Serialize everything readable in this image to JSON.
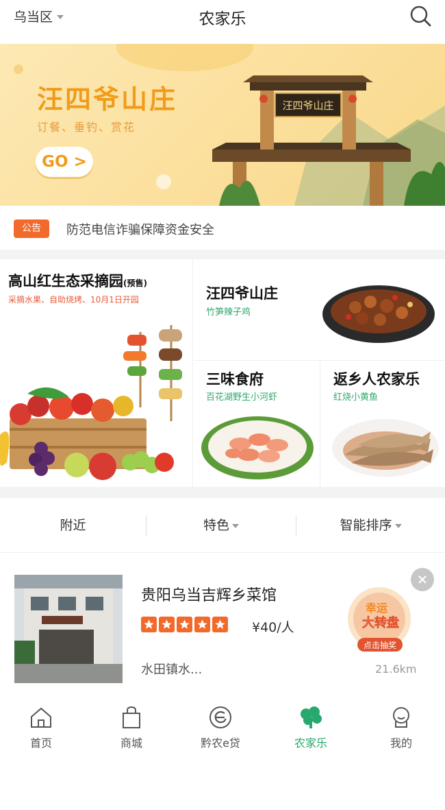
{
  "header": {
    "district": "乌当区",
    "title": "农家乐"
  },
  "banner": {
    "title": "汪四爷山庄",
    "subtitle": "订餐、垂钓、赏花",
    "button_label": "GO >",
    "gate_sign": "汪四爷山庄"
  },
  "notice": {
    "badge": "公告",
    "text": "防范电信诈骗保障资金安全"
  },
  "promo": {
    "left": {
      "title": "高山红生态采摘园",
      "tag": "(预售)",
      "subtitle": "采摘水果、自助烧烤、10月1日开园"
    },
    "cells": [
      {
        "title": "汪四爷山庄",
        "subtitle": "竹笋辣子鸡"
      },
      {
        "title": "三味食府",
        "subtitle": "百花湖野生小河虾"
      },
      {
        "title": "返乡人农家乐",
        "subtitle": "红烧小黄鱼"
      }
    ]
  },
  "filters": [
    {
      "label": "附近"
    },
    {
      "label": "特色"
    },
    {
      "label": "智能排序"
    }
  ],
  "restaurant": {
    "name": "贵阳乌当吉辉乡菜馆",
    "rating": 5,
    "rating_max": 5,
    "price": "¥40/人",
    "address": "水田镇水...",
    "distance": "21.6km",
    "lucky_badge_line1": "幸运",
    "lucky_badge_line2": "大转盘",
    "lucky_badge_button": "点击抽奖"
  },
  "tabbar": [
    {
      "label": "首页",
      "icon": "home-icon"
    },
    {
      "label": "商城",
      "icon": "shopping-bag-icon"
    },
    {
      "label": "黔农e贷",
      "icon": "loan-icon"
    },
    {
      "label": "农家乐",
      "icon": "farmhouse-icon",
      "active": true
    },
    {
      "label": "我的",
      "icon": "profile-icon"
    }
  ],
  "colors": {
    "accent_green": "#28a86c",
    "accent_orange": "#f26a2b",
    "banner_yellow": "#fbdf9c",
    "banner_text": "#f19b1a"
  }
}
